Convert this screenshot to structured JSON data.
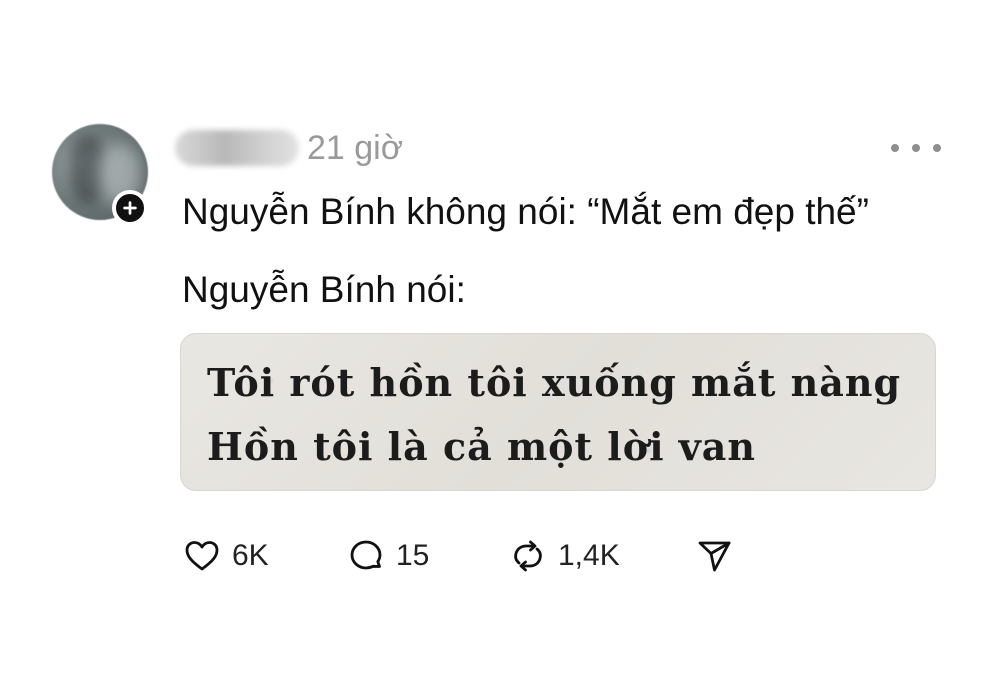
{
  "post": {
    "username": "username",
    "time": "21 giờ",
    "text_line_1": "Nguyễn Bính không nói: “Mắt em đẹp thế”",
    "text_line_2": "Nguyễn Bính nói:",
    "image_poem": {
      "line_1": "Tôi rót hồn tôi xuống mắt nàng",
      "line_2": "Hồn tôi là cả một lời van"
    }
  },
  "actions": {
    "likes": "6K",
    "replies": "15",
    "reposts": "1,4K"
  },
  "icons": {
    "like": "heart-icon",
    "reply": "comment-icon",
    "repost": "repost-icon",
    "share": "send-icon",
    "more": "more-icon",
    "follow": "plus-icon"
  },
  "colors": {
    "text": "#111111",
    "muted": "#9a9a9a",
    "background": "#ffffff"
  }
}
